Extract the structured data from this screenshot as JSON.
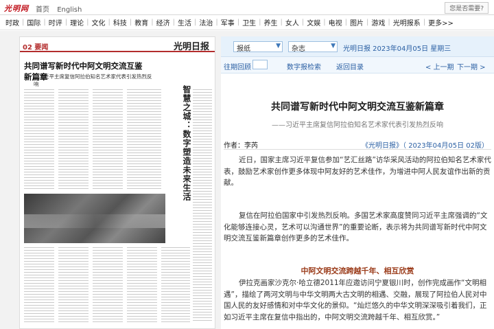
{
  "topbar": {
    "logo": "光明网",
    "links": [
      "首页",
      "English"
    ],
    "help": "您是否需要?"
  },
  "nav": [
    "时政",
    "国际",
    "时评",
    "理论",
    "文化",
    "科技",
    "教育",
    "经济",
    "生活",
    "法治",
    "军事",
    "卫生",
    "养生",
    "女人",
    "文娱",
    "电视",
    "图片",
    "游戏",
    "光明报系",
    "更多>>"
  ],
  "newspaper": {
    "page_label": "02 要闻",
    "brand": "光明日报",
    "headline": "共同谱写新时代中阿文明交流互鉴新篇章",
    "subheadline": "—习近平主席复信阿拉伯知名艺术家代表引发热烈反响",
    "vertical_title": "智慧之城：数字塑造未来生活"
  },
  "toolbar": {
    "paper_select": "报纸",
    "magazine_select": "杂志",
    "date_label": "光明日报 2023年04月05日 星期三",
    "past_label": "往期回顾",
    "digital_label": "数字报检索",
    "return_label": "返回目录",
    "prev_label": "< 上一期",
    "next_label": "下一期 >"
  },
  "article": {
    "title": "共同谱写新时代中阿文明交流互鉴新篇章",
    "subtitle": "——习近平主席复信阿拉伯知名艺术家代表引发热烈反响",
    "author": "作者：李芮",
    "source": "《光明日报》（ 2023年04月05日  02版）",
    "p1": "近日，国家主席习近平复信参加“艺汇丝路”访华采风活动的阿拉伯知名艺术家代表，鼓励艺术家创作更多体现中阿友好的艺术佳作，为增进中阿人民友谊作出新的贡献。",
    "p2": "复信在阿拉伯国家中引发热烈反响。多国艺术家高度赞同习近平主席强调的“文化能够连接心灵，艺术可以沟通世界”的重要论断，表示将为共同谱写新时代中阿文明交流互鉴新篇章创作更多的艺术佳作。",
    "section": "中阿文明交流跨越千年、相互欣赏",
    "p3": "伊拉克画家沙克尔·哈立德2011年应邀访问宁夏银川时，创作完成画作“文明相遇”，描绘了两河文明与中华文明两大古文明的相遇、交融，展现了阿拉伯人民对中国人民的友好感情和对中华文化的景仰。“灿烂悠久的中华文明深深吸引着我们，正如习近平主席在复信中指出的，中阿文明交流跨越千年、相互欣赏。”"
  }
}
